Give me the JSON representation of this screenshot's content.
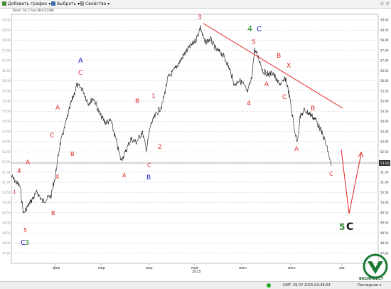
{
  "toolbar": {
    "add_chart": "Добавить график",
    "select": "Выбрать",
    "properties": "Свойства",
    "caret": "▾"
  },
  "chart_info": "Brent: 1d: 1 hour Bid (53.68)",
  "price_labels": [
    "59.00",
    "58.50",
    "58.00",
    "57.50",
    "57.00",
    "56.50",
    "56.00",
    "55.50",
    "55.00",
    "54.50",
    "54.00",
    "53.50",
    "53.00",
    "52.50",
    "52.00",
    "51.50",
    "51.00",
    "50.50",
    "50.00",
    "49.50",
    "49.00",
    "48.50",
    "48.00",
    "47.50"
  ],
  "current_price": "51.85",
  "month_labels": [
    "фев",
    "мар",
    "апр",
    "май",
    "июн",
    "июл",
    "авг"
  ],
  "year_label": "2015",
  "wave_labels": [
    {
      "text": "4",
      "color": "#dd2a2a"
    },
    {
      "text": "A",
      "color": "#dd2a2a"
    },
    {
      "text": "1",
      "color": "#dd2a2a"
    },
    {
      "text": "5",
      "color": "#dd2a2a"
    },
    {
      "text": "C",
      "color": "#2222cc"
    },
    {
      "text": "3",
      "color": "#2a8a2a"
    },
    {
      "text": "B",
      "color": "#dd2a2a"
    },
    {
      "text": "X",
      "color": "#dd2a2a"
    },
    {
      "text": "C",
      "color": "#dd2a2a"
    },
    {
      "text": "A",
      "color": "#dd2a2a"
    },
    {
      "text": "B",
      "color": "#dd2a2a"
    },
    {
      "text": "C",
      "color": "#dd2a2a"
    },
    {
      "text": "A",
      "color": "#2222cc"
    },
    {
      "text": "A",
      "color": "#dd2a2a"
    },
    {
      "text": "B",
      "color": "#2222cc"
    },
    {
      "text": "C",
      "color": "#dd2a2a"
    },
    {
      "text": "B",
      "color": "#dd2a2a"
    },
    {
      "text": "1",
      "color": "#dd2a2a"
    },
    {
      "text": "2",
      "color": "#dd2a2a"
    },
    {
      "text": "3",
      "color": "#dd2a2a"
    },
    {
      "text": "4",
      "color": "#2a8a2a"
    },
    {
      "text": "C",
      "color": "#2222cc"
    },
    {
      "text": "5",
      "color": "#dd2a2a"
    },
    {
      "text": "A",
      "color": "#dd2a2a"
    },
    {
      "text": "4",
      "color": "#dd2a2a"
    },
    {
      "text": "B",
      "color": "#dd2a2a"
    },
    {
      "text": "X",
      "color": "#dd2a2a"
    },
    {
      "text": "C",
      "color": "#dd2a2a"
    },
    {
      "text": "B",
      "color": "#dd2a2a"
    },
    {
      "text": "A",
      "color": "#dd2a2a"
    },
    {
      "text": "C",
      "color": "#dd2a2a"
    },
    {
      "text": "5",
      "color": "#2a8a2a"
    },
    {
      "text": "C",
      "color": "#111111"
    }
  ],
  "status": {
    "gmt": "GMT: 29.07.2015 04:49:03",
    "last": "Последние к"
  },
  "logo_text": "ВАСИНВЕСТ",
  "colors": {
    "background": "#ffffff",
    "price_line": "#111111",
    "grid": "#c8c8c8",
    "trendline": "#e32020",
    "forecast": "#e32020",
    "logo_green": "#1a7a34",
    "status_dot": "#22aa22"
  }
}
